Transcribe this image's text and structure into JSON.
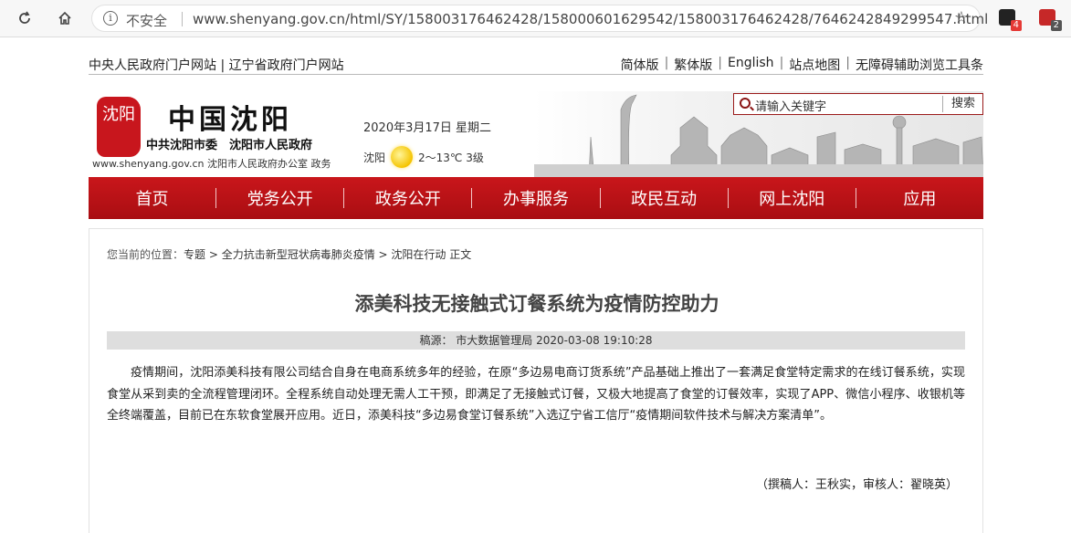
{
  "browser": {
    "insecure_label": "不安全",
    "url": "www.shenyang.gov.cn/html/SY/158003176462428/158000601629542/158003176462428/7646242849299547.html",
    "ext_badge_1": "4",
    "ext_badge_2": "2"
  },
  "toplinks": {
    "left": "中央人民政府门户网站 | 辽宁省政府门户网站",
    "right": [
      "简体版",
      "繁体版",
      "English",
      "站点地图",
      "无障碍辅助浏览工具条"
    ]
  },
  "header": {
    "logo_text": "沈阳",
    "site_name": "中国沈阳",
    "gov_name": "中共沈阳市委　沈阳市人民政府",
    "site_url": "www.shenyang.gov.cn 沈阳市人民政府办公室  政务",
    "date": "2020年3月17日 星期二",
    "weather_city": "沈阳",
    "weather_temp": "2～13℃ 3级",
    "search_placeholder": "请输入关键字",
    "search_button": "搜索"
  },
  "nav": [
    "首页",
    "党务公开",
    "政务公开",
    "办事服务",
    "政民互动",
    "网上沈阳",
    "应用"
  ],
  "article": {
    "breadcrumb_label": "您当前的位置：",
    "breadcrumb": "专题 > 全力抗击新型冠状病毒肺炎疫情 > 沈阳在行动 正文",
    "title": "添美科技无接触式订餐系统为疫情防控助力",
    "source": "稿源：  市大数据管理局 2020-03-08 19:10:28",
    "body": "疫情期间，沈阳添美科技有限公司结合自身在电商系统多年的经验，在原“多边易电商订货系统”产品基础上推出了一套满足食堂特定需求的在线订餐系统，实现食堂从采到卖的全流程管理闭环。全程系统自动处理无需人工干预，即满足了无接触式订餐，又极大地提高了食堂的订餐效率，实现了APP、微信小程序、收银机等全终端覆盖，目前已在东软食堂展开应用。近日，添美科技“多边易食堂订餐系统”入选辽宁省工信厅“疫情期间软件技术与解决方案清单”。",
    "signature": "（撰稿人：王秋实，审核人：翟晓英）"
  }
}
